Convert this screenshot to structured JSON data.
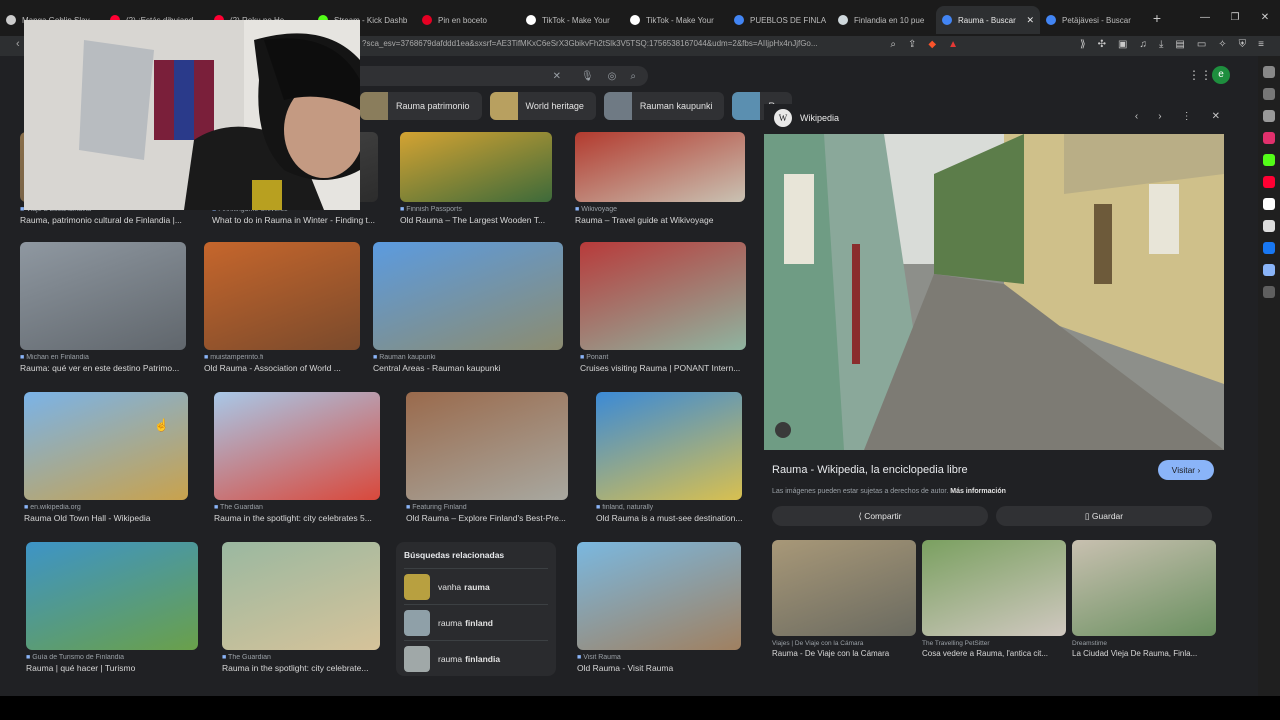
{
  "tabs": [
    {
      "label": "Manga Goblin Slay",
      "color": "#cccccc"
    },
    {
      "label": "(2) ¡Estás dibujand",
      "color": "#ff0033"
    },
    {
      "label": "(2) Roku no He",
      "color": "#ff0033"
    },
    {
      "label": "Stream - Kick Dashb",
      "color": "#53fc18"
    },
    {
      "label": "Pin en boceto",
      "color": "#e60023"
    },
    {
      "label": "TikTok - Make Your",
      "color": "#ffffff"
    },
    {
      "label": "TikTok - Make Your",
      "color": "#ffffff"
    },
    {
      "label": "PUEBLOS DE FINLA",
      "color": "#4285f4"
    },
    {
      "label": "Finlandia en 10 pue",
      "color": "#cfd8dc"
    },
    {
      "label": "Rauma - Buscar",
      "color": "#4285f4",
      "active": true
    },
    {
      "label": "Petäjävesi - Buscar",
      "color": "#4285f4"
    }
  ],
  "toolbar": {
    "url": "?sca_esv=3768679dafddd1ea&sxsrf=AE3TifMKxC6eSrX3GbikvFh2tSlk3V5TSQ:1756538167044&udm=2&fbs=AIIjpHx4nJjfGo..."
  },
  "google": {
    "avatar_letter": "e",
    "chips": [
      {
        "label": "Rauma patrimonio",
        "color": "#8a7d5c"
      },
      {
        "label": "World heritage",
        "color": "#b8a060"
      },
      {
        "label": "Rauman kaupunki",
        "color": "#6f7a84"
      },
      {
        "label": "Ra",
        "color": "#5b8fb0"
      }
    ]
  },
  "results": [
    {
      "source": "Viaje a Escandinavia",
      "title": "Rauma, patrimonio cultural de Finlandia |...",
      "colors": [
        "#8a6f4a",
        "#6b5a45"
      ]
    },
    {
      "source": "Finnkingdme Universe",
      "title": "What to do in Rauma in Winter - Finding t...",
      "colors": [
        "#4a4a4a",
        "#2c2c2c"
      ]
    },
    {
      "source": "Finnish Passports",
      "title": "Old Rauma – The Largest Wooden T...",
      "colors": [
        "#d4a332",
        "#3d6a3a"
      ]
    },
    {
      "source": "Wikivoyage",
      "title": "Rauma – Travel guide at Wikivoyage",
      "colors": [
        "#b33a2e",
        "#c9c2b3"
      ]
    },
    {
      "source": "Michan en Finlandia",
      "title": "Rauma: qué ver en este destino Patrimo...",
      "colors": [
        "#8f98a1",
        "#60666c"
      ]
    },
    {
      "source": "muistamperinto.fi",
      "title": "Old Rauma - Association of World ...",
      "colors": [
        "#c6662c",
        "#7a4a2c"
      ]
    },
    {
      "source": "Rauman kaupunki",
      "title": "Central Areas - Rauman kaupunki",
      "colors": [
        "#5b9be0",
        "#8c8c70"
      ]
    },
    {
      "source": "Ponant",
      "title": "Cruises visiting Rauma | PONANT Intern...",
      "colors": [
        "#b83a3a",
        "#8fb4a0"
      ]
    },
    {
      "source": "en.wikipedia.org",
      "title": "Rauma Old Town Hall - Wikipedia",
      "colors": [
        "#7ab3e8",
        "#c9a24c"
      ]
    },
    {
      "source": "The Guardian",
      "title": "Rauma in the spotlight: city celebrates 5...",
      "colors": [
        "#a8c8e8",
        "#d9483b"
      ]
    },
    {
      "source": "Featuring Finland",
      "title": "Old Rauma – Explore Finland's Best-Pre...",
      "colors": [
        "#9a6a4c",
        "#a8a8a0"
      ]
    },
    {
      "source": "finland, naturally",
      "title": "Old Rauma is a must-see destination...",
      "colors": [
        "#3b8ad6",
        "#d8c050"
      ]
    },
    {
      "source": "Guía de Turismo de Finlandia",
      "title": "Rauma | qué hacer | Turismo",
      "colors": [
        "#3d94c7",
        "#6aa04a"
      ]
    },
    {
      "source": "The Guardian",
      "title": "Rauma in the spotlight: city celebrate...",
      "colors": [
        "#9ab8a0",
        "#d6c39a"
      ]
    },
    {
      "source": "Visit Rauma",
      "title": "Old Rauma - Visit Rauma",
      "colors": [
        "#7ab8e0",
        "#a08060"
      ]
    }
  ],
  "related": {
    "heading": "Búsquedas relacionadas",
    "items": [
      {
        "normal": "vanha",
        "bold": "rauma",
        "color": "#b8a040"
      },
      {
        "normal": "rauma",
        "bold": "finland",
        "color": "#8fa0a8"
      },
      {
        "normal": "rauma",
        "bold": "finlandia",
        "color": "#a0a8a8"
      }
    ]
  },
  "panel": {
    "site": "Wikipedia",
    "logo_letter": "W",
    "title": "Rauma - Wikipedia, la enciclopedia libre",
    "visit_label": "Visitar ›",
    "rights": "Las imágenes pueden estar sujetas a derechos de autor.",
    "more_info": "Más información",
    "share_label": "Compartir",
    "save_label": "Guardar",
    "thumbs": [
      {
        "source": "Viajes | De Viaje con la Cámara",
        "title": "Rauma - De Viaje con la Cámara",
        "colors": [
          "#a89878",
          "#6a6a60"
        ]
      },
      {
        "source": "The Travelling PetSitter",
        "title": "Cosa vedere a Rauma, l'antica cit...",
        "colors": [
          "#7aa060",
          "#d0c8c0"
        ]
      },
      {
        "source": "Dreamstime",
        "title": "La Ciudad Vieja De Rauma, Finla...",
        "colors": [
          "#c8c0b0",
          "#6a9060"
        ]
      }
    ]
  }
}
